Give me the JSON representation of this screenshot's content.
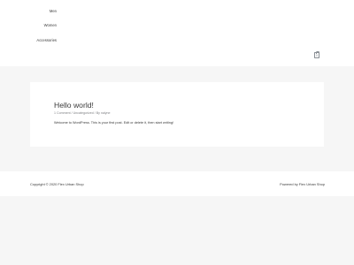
{
  "nav": {
    "items": [
      "Men",
      "Women",
      "Accessories"
    ]
  },
  "cart": {
    "count": "0"
  },
  "post": {
    "title": "Hello world!",
    "comments": "1 Comment",
    "category": "Uncategorized",
    "by_label": "By",
    "author": "nalyne",
    "separator": "/",
    "excerpt": "Welcome to WordPress. This is your first post. Edit or delete it, then start writing!"
  },
  "footer": {
    "copyright": "Copyright © 2020 Flex Urban Shop",
    "powered": "Powered by Flex Urban Shop"
  }
}
